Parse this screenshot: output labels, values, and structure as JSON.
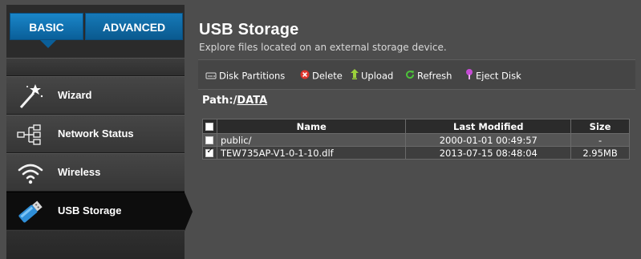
{
  "tabs": {
    "basic": "BASIC",
    "advanced": "ADVANCED"
  },
  "sidebar": {
    "items": [
      {
        "label": "Wizard",
        "icon": "wand-icon"
      },
      {
        "label": "Network Status",
        "icon": "network-tree-icon"
      },
      {
        "label": "Wireless",
        "icon": "wifi-icon"
      },
      {
        "label": "USB Storage",
        "icon": "usb-icon",
        "active": true
      }
    ]
  },
  "page": {
    "title": "USB Storage",
    "subtitle": "Explore files located on an external storage device."
  },
  "toolbar": {
    "disk_partitions": "Disk Partitions",
    "delete": "Delete",
    "upload": "Upload",
    "refresh": "Refresh",
    "eject": "Eject Disk"
  },
  "path": {
    "label": "Path:/",
    "folder": "DATA"
  },
  "table": {
    "columns": [
      "Name",
      "Last Modified",
      "Size"
    ],
    "rows": [
      {
        "name": "public/",
        "modified": "2000-01-01 00:49:57",
        "size": "-",
        "checked": false
      },
      {
        "name": "TEW735AP-V1-0-1-10.dlf",
        "modified": "2013-07-15 08:48:04",
        "size": "2.95MB",
        "checked": true
      }
    ]
  },
  "colors": {
    "accent": "#0a5f99",
    "background": "#4d4d4d",
    "sidebar": "#2b2b2b",
    "active_item": "#0d0d0d"
  }
}
